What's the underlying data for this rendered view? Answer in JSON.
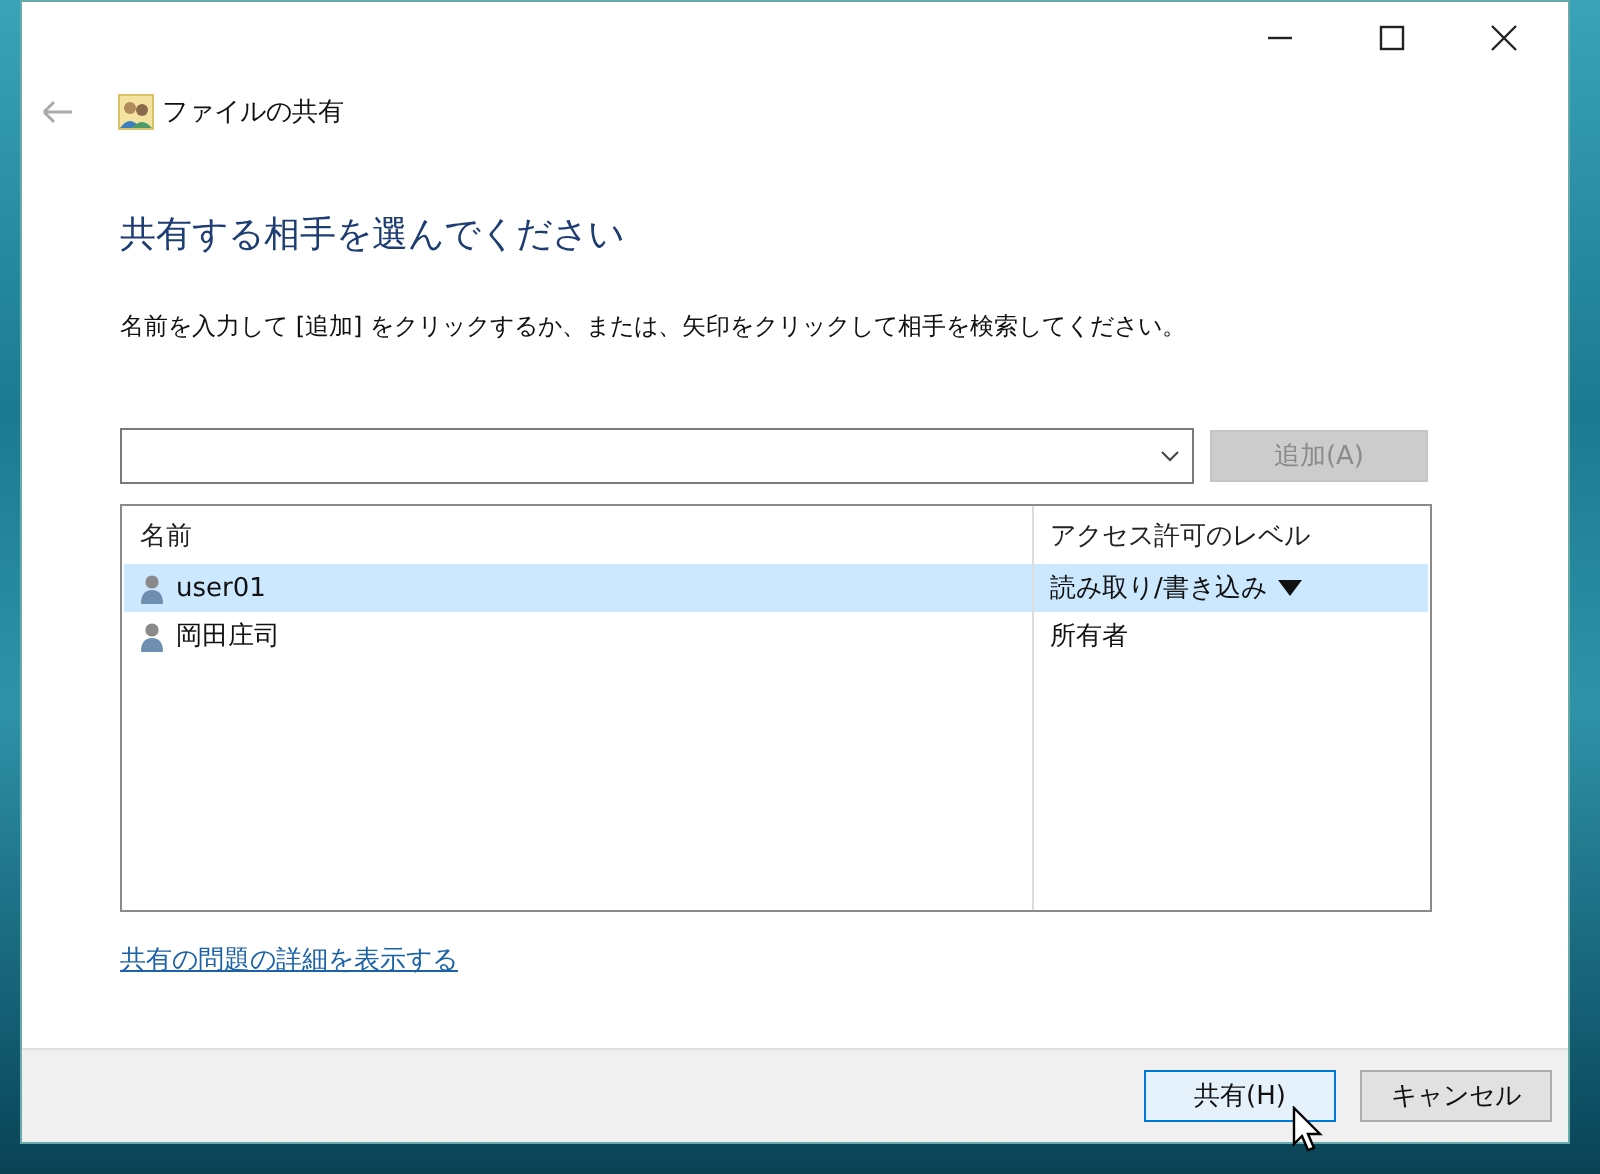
{
  "window": {
    "title": "ファイルの共有"
  },
  "heading": "共有する相手を選んでください",
  "instruction": "名前を入力して [追加] をクリックするか、または、矢印をクリックして相手を検索してください。",
  "add_button": {
    "label": "追加(A)",
    "disabled": true
  },
  "table": {
    "columns": [
      "名前",
      "アクセス許可のレベル"
    ],
    "rows": [
      {
        "name": "user01",
        "access": "読み取り/書き込み",
        "selected": true
      },
      {
        "name": "岡田庄司",
        "access": "所有者",
        "selected": false
      }
    ]
  },
  "link": "共有の問題の詳細を表示する",
  "buttons": [
    {
      "label": "共有(H)",
      "default": true
    },
    {
      "label": "キャンセル",
      "default": false
    }
  ]
}
